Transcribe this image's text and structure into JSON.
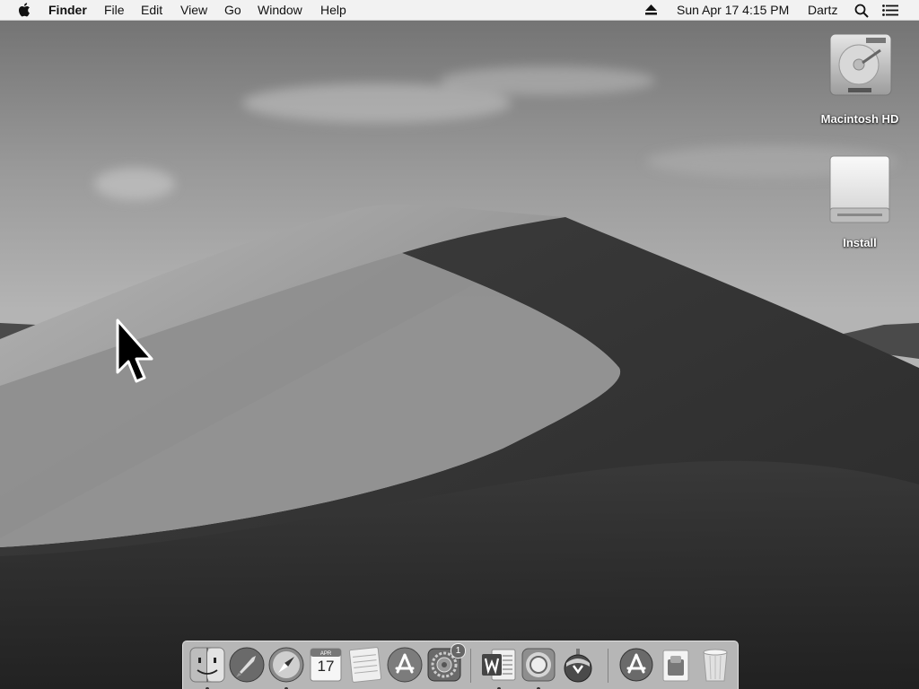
{
  "menubar": {
    "apple_icon": "apple-icon",
    "app_name": "Finder",
    "menus": [
      "File",
      "Edit",
      "View",
      "Go",
      "Window",
      "Help"
    ],
    "status": {
      "eject_icon": "eject-icon",
      "datetime": "Sun Apr 17  4:15 PM",
      "user": "Dartz",
      "search_icon": "spotlight-search-icon",
      "notification_icon": "notification-center-icon"
    }
  },
  "desktop": {
    "icons": [
      {
        "label": "Macintosh HD",
        "icon": "hard-drive-icon"
      },
      {
        "label": "Install",
        "icon": "external-drive-icon"
      }
    ]
  },
  "dock": {
    "apps": [
      {
        "icon": "finder-icon",
        "running": true
      },
      {
        "icon": "launchpad-icon",
        "running": false
      },
      {
        "icon": "safari-icon",
        "running": true
      },
      {
        "icon": "calendar-icon",
        "running": false,
        "month": "APR",
        "day": "17"
      },
      {
        "icon": "notes-icon",
        "running": false
      },
      {
        "icon": "app-store-icon",
        "running": false
      },
      {
        "icon": "system-preferences-icon",
        "running": false,
        "badge": "1"
      },
      {
        "icon": "word-icon",
        "running": true
      },
      {
        "icon": "chrome-icon",
        "running": true
      },
      {
        "icon": "installer-icon",
        "running": false
      },
      {
        "icon": "app-store-downloads-icon",
        "running": false
      },
      {
        "icon": "document-stack-icon",
        "running": false
      },
      {
        "icon": "trash-icon",
        "running": false
      }
    ]
  }
}
